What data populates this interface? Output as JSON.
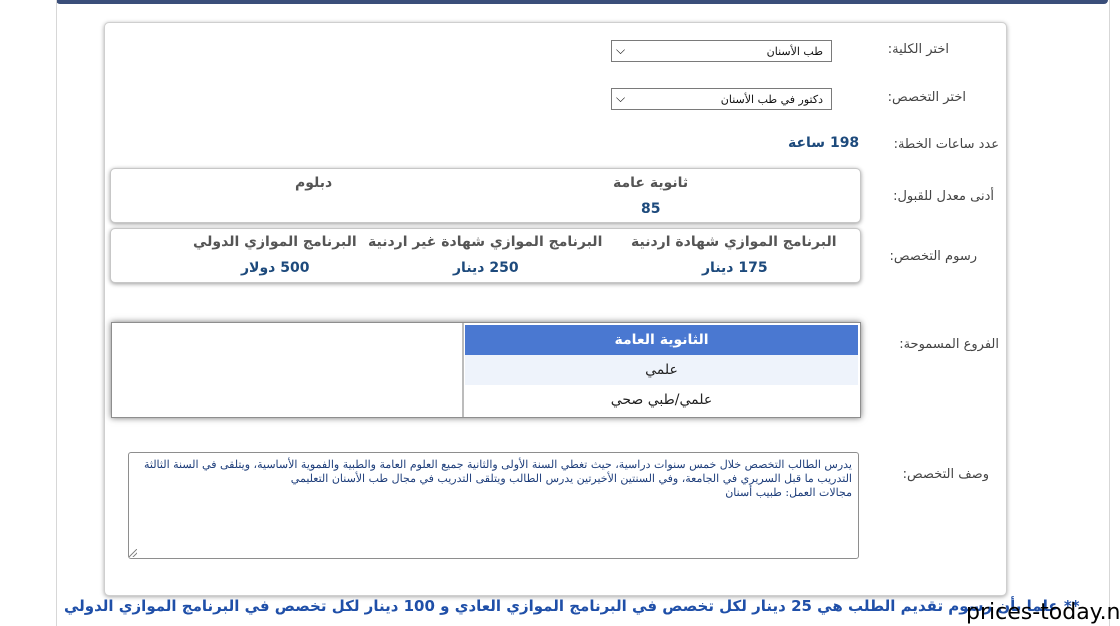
{
  "form": {
    "college_label": "اختر الكلية:",
    "college_value": "طب الأسنان",
    "major_label": "اختر التخصص:",
    "major_value": "دكتور في طب الأسنان",
    "hours_label": "عدد ساعات الخطة:",
    "hours_value": "198 ساعة",
    "min_avg_label": "أدنى معدل للقبول:",
    "min_avg": {
      "tawjihi_head": "ثانوية عامة",
      "tawjihi_value": "85",
      "diploma_head": "دبلوم",
      "diploma_value": ""
    },
    "fees_label": "رسوم التخصص:",
    "fees": [
      {
        "head": "البرنامج الموازي شهادة اردنية",
        "value": "175 دينار"
      },
      {
        "head": "البرنامج الموازي شهادة غير اردنية",
        "value": "250 دينار"
      },
      {
        "head": "البرنامج الموازي الدولي",
        "value": "500 دولار"
      }
    ],
    "branches_label": "الفروع المسموحة:",
    "branches": {
      "header": "الثانوية العامة",
      "items": [
        "علمي",
        "علمي/طبي صحي"
      ]
    },
    "desc_label": "وصف التخصص:",
    "desc_text": "يدرس الطالب التخصص خلال خمس سنوات دراسية، حيث تغطي السنة الأولى والثانية جميع العلوم العامة والطبية والفموية الأساسية، ويتلقى في السنة الثالثة التدريب ما قبل السريري في الجامعة، وفي السنتين الأخيرتين يدرس الطالب ويتلقى التدريب في مجال طب الأسنان التعليمي",
    "desc_field": "مجالات العمل: طبيب أسنان"
  },
  "note": "** علما بأن رسوم تقديم الطلب هي 25 دينار لكل تخصص في البرنامج الموازي العادي و 100 دينار لكل تخصص في البرنامج الموازي الدولي",
  "watermark": "prices-today.net",
  "colors": {
    "accent": "#4a78d1",
    "value_text": "#1d4a7c",
    "note_text": "#1f4fa8"
  }
}
